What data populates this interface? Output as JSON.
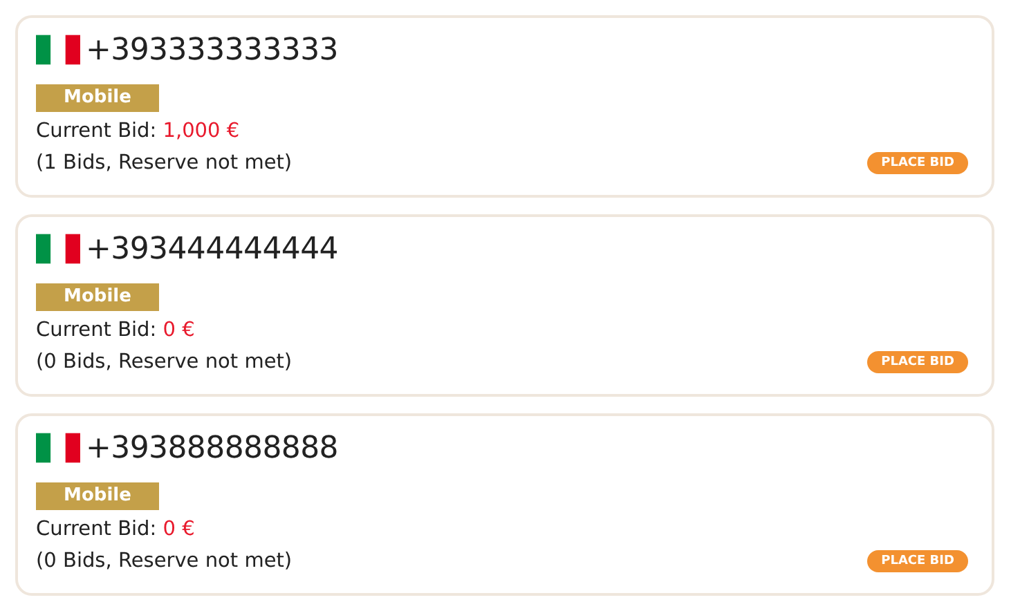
{
  "listings": [
    {
      "number": "+393333333333",
      "type": "Mobile",
      "bid_label": "Current Bid:",
      "bid": "1,000 €",
      "summary": "(1 Bids, Reserve not met)",
      "action": "PLACE BID"
    },
    {
      "number": "+393444444444",
      "type": "Mobile",
      "bid_label": "Current Bid:",
      "bid": "0 €",
      "summary": "(0 Bids, Reserve not met)",
      "action": "PLACE BID"
    },
    {
      "number": "+393888888888",
      "type": "Mobile",
      "bid_label": "Current Bid:",
      "bid": "0 €",
      "summary": "(0 Bids, Reserve not met)",
      "action": "PLACE BID"
    }
  ]
}
